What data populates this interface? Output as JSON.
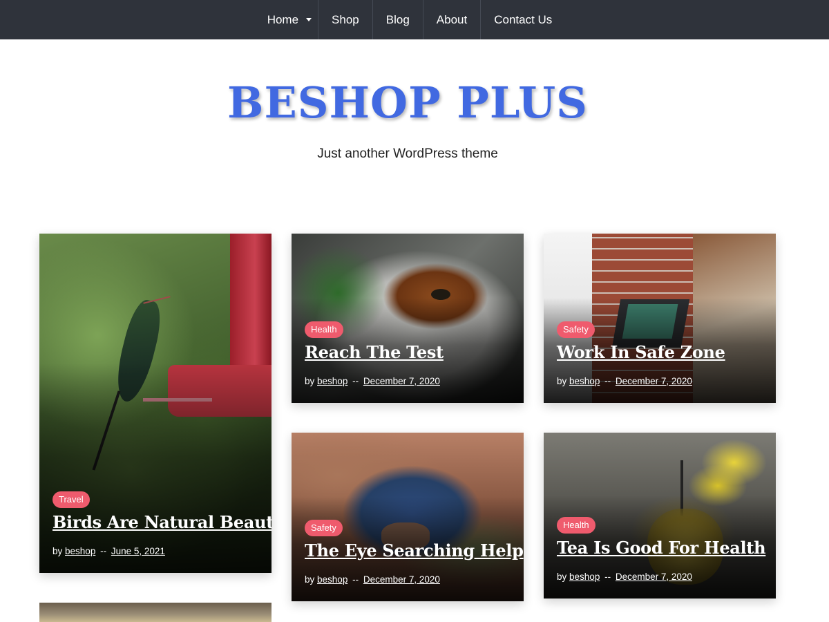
{
  "nav": {
    "items": [
      {
        "label": "Home",
        "has_submenu": true
      },
      {
        "label": "Shop"
      },
      {
        "label": "Blog"
      },
      {
        "label": "About"
      },
      {
        "label": "Contact Us"
      }
    ]
  },
  "header": {
    "site_title": "BESHOP PLUS",
    "tagline": "Just another WordPress theme"
  },
  "colors": {
    "nav_bg": "#2f333b",
    "title": "#4169e1",
    "badge": "#ef5b6d"
  },
  "posts": [
    {
      "category": "Travel",
      "title": "Birds Are Natural Beauty",
      "by": "by",
      "author": "beshop",
      "separator": "--",
      "date": "June 5, 2021",
      "image": "hummingbird-photo"
    },
    {
      "category": "Health",
      "title": "Reach The Test",
      "by": "by",
      "author": "beshop",
      "separator": "--",
      "date": "December 7, 2020",
      "image": "bagel-photo"
    },
    {
      "category": "Safety",
      "title": "Work In Safe Zone",
      "by": "by",
      "author": "beshop",
      "separator": "--",
      "date": "December 7, 2020",
      "image": "laptop-brick-wall-photo"
    },
    {
      "category": "Safety",
      "title": "The Eye Searching Help",
      "by": "by",
      "author": "beshop",
      "separator": "--",
      "date": "December 7, 2020",
      "image": "desert-traveler-photo"
    },
    {
      "category": "Health",
      "title": "Tea Is Good For Health",
      "by": "by",
      "author": "beshop",
      "separator": "--",
      "date": "December 7, 2020",
      "image": "teapot-flowers-photo"
    }
  ]
}
